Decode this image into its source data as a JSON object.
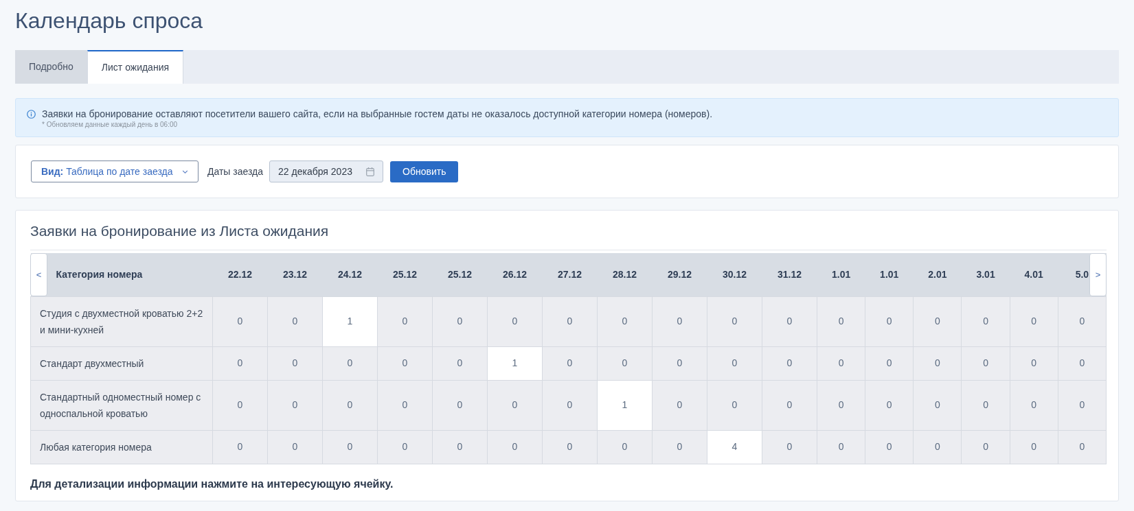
{
  "page_title": "Календарь спроса",
  "tabs": [
    {
      "label": "Подробно",
      "selected": false
    },
    {
      "label": "Лист ожидания",
      "selected": true
    }
  ],
  "info": {
    "text": "Заявки на бронирование оставляют посетители вашего сайта, если на выбранные гостем даты не оказалось доступной категории номера (номеров).",
    "note": "* Обновляем данные каждый день в 06:00"
  },
  "filters": {
    "view_dropdown": "**Вид:** Таблица по дате заезда",
    "date_label": "Даты заезда",
    "date_field": {
      "value": "22 декабря 2023"
    },
    "refresh_button": "Обновить"
  },
  "waitlist": {
    "title": "Заявки на бронирование из Листа ожидания",
    "table": {
      "scroll_left": "<",
      "scroll_right": ">",
      "columns": [
        "Категория номера",
        "22.12",
        "23.12",
        "24.12",
        "25.12",
        "25.12",
        "26.12",
        "27.12",
        "28.12",
        "29.12",
        "30.12",
        "31.12",
        "1.01",
        "1.01",
        "2.01",
        "3.01",
        "4.01",
        "5.0"
      ],
      "rows": [
        {
          "cells": [
            {
              "value": "Студия с двухместной кроватью 2+2 и мини-кухней",
              "highlighted": false
            },
            {
              "value": "0",
              "highlighted": false
            },
            {
              "value": "0",
              "highlighted": false
            },
            {
              "value": "1",
              "highlighted": true
            },
            {
              "value": "0",
              "highlighted": false
            },
            {
              "value": "0",
              "highlighted": false
            },
            {
              "value": "0",
              "highlighted": false
            },
            {
              "value": "0",
              "highlighted": false
            },
            {
              "value": "0",
              "highlighted": false
            },
            {
              "value": "0",
              "highlighted": false
            },
            {
              "value": "0",
              "highlighted": false
            },
            {
              "value": "0",
              "highlighted": false
            },
            {
              "value": "0",
              "highlighted": false
            },
            {
              "value": "0",
              "highlighted": false
            },
            {
              "value": "0",
              "highlighted": false
            },
            {
              "value": "0",
              "highlighted": false
            },
            {
              "value": "0",
              "highlighted": false
            },
            {
              "value": "0",
              "highlighted": false
            }
          ]
        },
        {
          "cells": [
            {
              "value": "Стандарт двухместный",
              "highlighted": false
            },
            {
              "value": "0",
              "highlighted": false
            },
            {
              "value": "0",
              "highlighted": false
            },
            {
              "value": "0",
              "highlighted": false
            },
            {
              "value": "0",
              "highlighted": false
            },
            {
              "value": "0",
              "highlighted": false
            },
            {
              "value": "1",
              "highlighted": true
            },
            {
              "value": "0",
              "highlighted": false
            },
            {
              "value": "0",
              "highlighted": false
            },
            {
              "value": "0",
              "highlighted": false
            },
            {
              "value": "0",
              "highlighted": false
            },
            {
              "value": "0",
              "highlighted": false
            },
            {
              "value": "0",
              "highlighted": false
            },
            {
              "value": "0",
              "highlighted": false
            },
            {
              "value": "0",
              "highlighted": false
            },
            {
              "value": "0",
              "highlighted": false
            },
            {
              "value": "0",
              "highlighted": false
            },
            {
              "value": "0",
              "highlighted": false
            }
          ]
        },
        {
          "cells": [
            {
              "value": "Стандартный одноместный номер с односпальной кроватью",
              "highlighted": false
            },
            {
              "value": "0",
              "highlighted": false
            },
            {
              "value": "0",
              "highlighted": false
            },
            {
              "value": "0",
              "highlighted": false
            },
            {
              "value": "0",
              "highlighted": false
            },
            {
              "value": "0",
              "highlighted": false
            },
            {
              "value": "0",
              "highlighted": false
            },
            {
              "value": "0",
              "highlighted": false
            },
            {
              "value": "1",
              "highlighted": true
            },
            {
              "value": "0",
              "highlighted": false
            },
            {
              "value": "0",
              "highlighted": false
            },
            {
              "value": "0",
              "highlighted": false
            },
            {
              "value": "0",
              "highlighted": false
            },
            {
              "value": "0",
              "highlighted": false
            },
            {
              "value": "0",
              "highlighted": false
            },
            {
              "value": "0",
              "highlighted": false
            },
            {
              "value": "0",
              "highlighted": false
            },
            {
              "value": "0",
              "highlighted": false
            }
          ]
        },
        {
          "cells": [
            {
              "value": "Любая категория номера",
              "highlighted": false
            },
            {
              "value": "0",
              "highlighted": false
            },
            {
              "value": "0",
              "highlighted": false
            },
            {
              "value": "0",
              "highlighted": false
            },
            {
              "value": "0",
              "highlighted": false
            },
            {
              "value": "0",
              "highlighted": false
            },
            {
              "value": "0",
              "highlighted": false
            },
            {
              "value": "0",
              "highlighted": false
            },
            {
              "value": "0",
              "highlighted": false
            },
            {
              "value": "0",
              "highlighted": false
            },
            {
              "value": "4",
              "highlighted": true
            },
            {
              "value": "0",
              "highlighted": false
            },
            {
              "value": "0",
              "highlighted": false
            },
            {
              "value": "0",
              "highlighted": false
            },
            {
              "value": "0",
              "highlighted": false
            },
            {
              "value": "0",
              "highlighted": false
            },
            {
              "value": "0",
              "highlighted": false
            },
            {
              "value": "0",
              "highlighted": false
            }
          ]
        }
      ]
    },
    "hint": "Для детализации информации нажмите на интересующую ячейку."
  }
}
